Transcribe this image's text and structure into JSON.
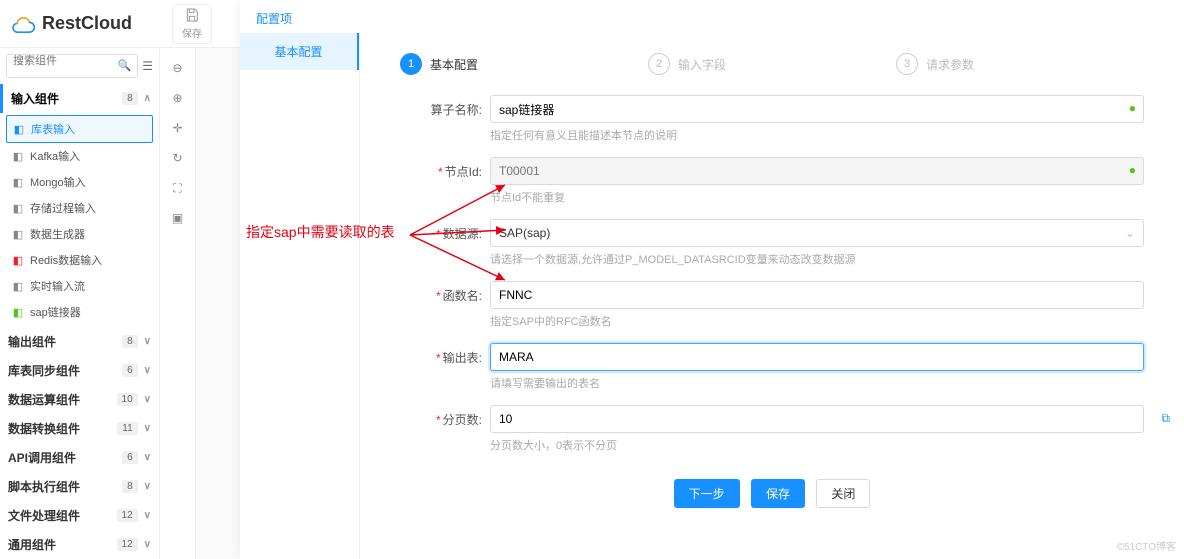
{
  "brand": "RestCloud",
  "toolbar": {
    "save": "保存"
  },
  "search": {
    "placeholder": "搜索组件"
  },
  "sidebar": {
    "groups": [
      {
        "name": "输入组件",
        "count": "8",
        "expanded": true,
        "active": true,
        "items": [
          {
            "label": "库表输入",
            "selected": true,
            "color": "#1890ff"
          },
          {
            "label": "Kafka输入",
            "color": "#888"
          },
          {
            "label": "Mongo输入",
            "color": "#888"
          },
          {
            "label": "存储过程输入",
            "color": "#888"
          },
          {
            "label": "数据生成器",
            "color": "#888"
          },
          {
            "label": "Redis数据输入",
            "color": "#f5222d"
          },
          {
            "label": "实时输入流",
            "color": "#888"
          },
          {
            "label": "sap链接器",
            "color": "#52c41a"
          }
        ]
      },
      {
        "name": "输出组件",
        "count": "8"
      },
      {
        "name": "库表同步组件",
        "count": "6"
      },
      {
        "name": "数据运算组件",
        "count": "10"
      },
      {
        "name": "数据转换组件",
        "count": "11"
      },
      {
        "name": "API调用组件",
        "count": "6"
      },
      {
        "name": "脚本执行组件",
        "count": "8"
      },
      {
        "name": "文件处理组件",
        "count": "12"
      },
      {
        "name": "通用组件",
        "count": "12"
      }
    ]
  },
  "modal": {
    "title": "配置项",
    "sideTab": "基本配置",
    "steps": [
      {
        "num": "1",
        "label": "基本配置",
        "active": true
      },
      {
        "num": "2",
        "label": "输入字段"
      },
      {
        "num": "3",
        "label": "请求参数"
      }
    ],
    "form": {
      "operator": {
        "label": "算子名称:",
        "value": "sap链接器",
        "hint": "指定任何有意义且能描述本节点的说明",
        "valid": true
      },
      "nodeId": {
        "label": "节点Id:",
        "placeholder": "T00001",
        "hint": "节点Id不能重复",
        "valid": true,
        "required": true
      },
      "dataSource": {
        "label": "数据源:",
        "value": "SAP(sap)",
        "hint": "请选择一个数据源,允许通过P_MODEL_DATASRCID变量来动态改变数据源",
        "required": true
      },
      "funcName": {
        "label": "函数名:",
        "value": "FNNC",
        "hint": "指定SAP中的RFC函数名",
        "required": true
      },
      "outTable": {
        "label": "输出表:",
        "value": "MARA",
        "hint": "请填写需要输出的表名",
        "required": true,
        "focused": true
      },
      "pageSize": {
        "label": "分页数:",
        "value": "10",
        "hint": "分页数大小，0表示不分页",
        "required": true,
        "ext": true
      }
    },
    "buttons": {
      "next": "下一步",
      "save": "保存",
      "close": "关闭"
    }
  },
  "annotation": "指定sap中需要读取的表",
  "watermark": "©51CTO博客"
}
